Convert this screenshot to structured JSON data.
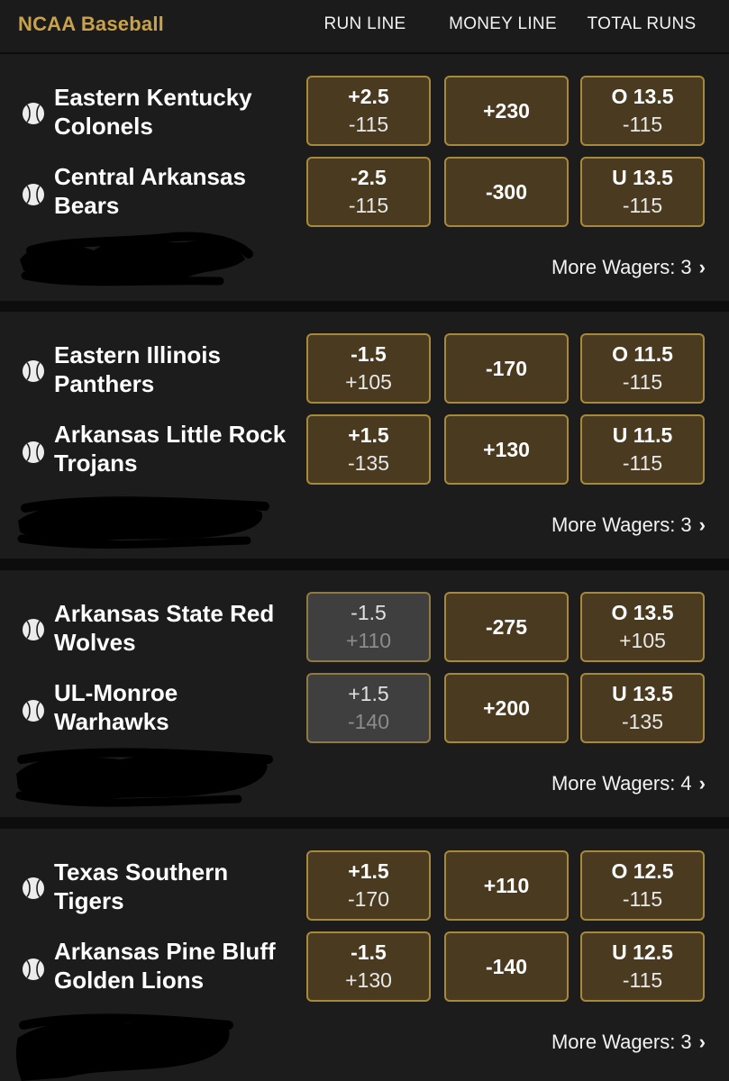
{
  "header": {
    "league": "NCAA Baseball",
    "col_run": "RUN LINE",
    "col_money": "MONEY LINE",
    "col_total": "TOTAL RUNS"
  },
  "games": [
    {
      "teams": [
        {
          "name": "Eastern Kentucky Colonels",
          "run_top": "+2.5",
          "run_bot": "-115",
          "money": "+230",
          "total_top": "O 13.5",
          "total_bot": "-115"
        },
        {
          "name": "Central Arkansas Bears",
          "run_top": "-2.5",
          "run_bot": "-115",
          "money": "-300",
          "total_top": "U 13.5",
          "total_bot": "-115"
        }
      ],
      "more": "More Wagers: 3"
    },
    {
      "teams": [
        {
          "name": "Eastern Illinois Panthers",
          "run_top": "-1.5",
          "run_bot": "+105",
          "money": "-170",
          "total_top": "O 11.5",
          "total_bot": "-115"
        },
        {
          "name": "Arkansas Little Rock Trojans",
          "run_top": "+1.5",
          "run_bot": "-135",
          "money": "+130",
          "total_top": "U 11.5",
          "total_bot": "-115"
        }
      ],
      "more": "More Wagers: 3"
    },
    {
      "teams": [
        {
          "name": "Arkansas State Red Wolves",
          "run_top": "-1.5",
          "run_bot": "+110",
          "money": "-275",
          "total_top": "O 13.5",
          "total_bot": "+105"
        },
        {
          "name": "UL-Monroe Warhawks",
          "run_top": "+1.5",
          "run_bot": "-140",
          "money": "+200",
          "total_top": "U 13.5",
          "total_bot": "-135"
        }
      ],
      "more": "More Wagers: 4"
    },
    {
      "teams": [
        {
          "name": "Texas Southern Tigers",
          "run_top": "+1.5",
          "run_bot": "-170",
          "money": "+110",
          "total_top": "O 12.5",
          "total_bot": "-115"
        },
        {
          "name": "Arkansas Pine Bluff Golden Lions",
          "run_top": "-1.5",
          "run_bot": "+130",
          "money": "-140",
          "total_top": "U 12.5",
          "total_bot": "-115"
        }
      ],
      "more": "More Wagers: 3"
    }
  ],
  "colors": {
    "accent": "#c9a24a",
    "button_bg": "#4a3a1f",
    "button_border": "#a7893c"
  },
  "icons": {
    "team": "baseball-icon",
    "more": "chevron-right-icon"
  }
}
